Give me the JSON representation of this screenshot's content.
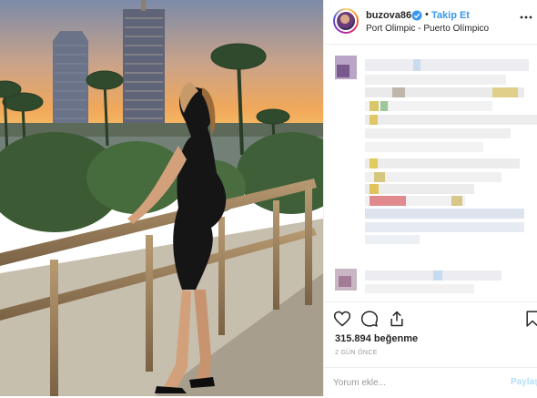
{
  "post": {
    "username": "buzova86",
    "verified": true,
    "dot": "•",
    "follow_label": "Takip Et",
    "location": "Port Olimpic - Puerto Olímpico",
    "likes": "315.894 beğenme",
    "time_ago": "2 GÜN ÖNCE",
    "comment_placeholder": "Yorum ekle...",
    "post_label": "Paylaş"
  },
  "colors": {
    "accent": "#3897f0",
    "text": "#262626",
    "muted": "#999999",
    "border": "#efefef"
  },
  "icons": [
    "verified-badge-icon",
    "more-options-icon",
    "heart-icon",
    "comment-icon",
    "share-icon",
    "bookmark-icon"
  ]
}
